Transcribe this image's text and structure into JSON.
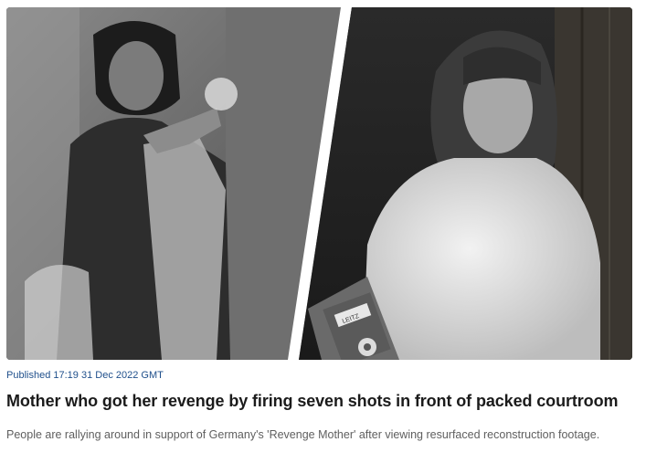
{
  "article": {
    "published_label": "Published",
    "published_time": "17:19 31 Dec 2022 GMT",
    "headline": "Mother who got her revenge by firing seven shots in front of packed courtroom",
    "summary": "People are rallying around in support of Germany's 'Revenge Mother' after viewing resurfaced reconstruction footage.",
    "binder_label": "LEITZ"
  }
}
